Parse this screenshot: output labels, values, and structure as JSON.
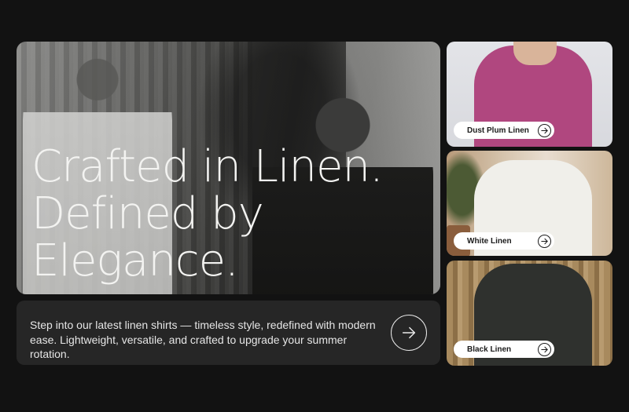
{
  "hero": {
    "headline_lines": [
      "Crafted in Linen.",
      "Defined by",
      "Elegance."
    ],
    "image": "black-and-white photo of two men in linen shirts beside bamboo and an olive tree"
  },
  "description": {
    "text": "Step into our latest linen shirts — timeless style, redefined with modern ease. Lightweight, versatile, and crafted to upgrade your summer rotation.",
    "cta_icon": "arrow-right-icon"
  },
  "products": [
    {
      "label": "Dust Plum Linen",
      "icon": "arrow-right-icon",
      "color": "#b0477f"
    },
    {
      "label": "White Linen",
      "icon": "arrow-right-icon",
      "color": "#f0efea"
    },
    {
      "label": "Black Linen",
      "icon": "arrow-right-icon",
      "color": "#2f312e"
    }
  ],
  "colors": {
    "background": "#121212",
    "card": "#262626",
    "text_light": "#f3f3f1"
  }
}
